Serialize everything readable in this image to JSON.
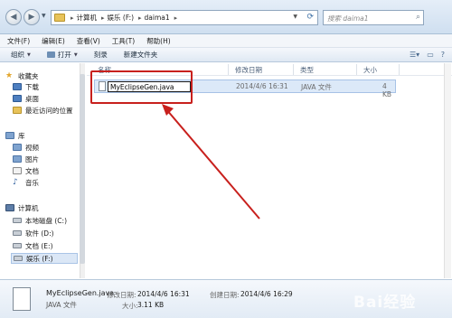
{
  "address": {
    "crumbs": [
      "计算机",
      "娱乐 (F:)",
      "daima1"
    ],
    "search_placeholder": "搜索 daima1"
  },
  "menu": [
    "文件(F)",
    "编辑(E)",
    "查看(V)",
    "工具(T)",
    "帮助(H)"
  ],
  "toolbar": {
    "organize": "组织",
    "open": "打开",
    "burn": "刻录",
    "new_folder": "新建文件夹"
  },
  "sidebar": {
    "favorites": "收藏夹",
    "downloads": "下载",
    "desktop": "桌面",
    "recent": "最近访问的位置",
    "libraries": "库",
    "videos": "视频",
    "pictures": "图片",
    "documents": "文档",
    "music": "音乐",
    "computer": "计算机",
    "local_disk": "本地磁盘 (C:)",
    "software": "软件 (D:)",
    "docs_drive": "文档 (E:)",
    "entertainment": "娱乐 (F:)"
  },
  "columns": {
    "name": "名称",
    "modified": "修改日期",
    "type": "类型",
    "size": "大小"
  },
  "file": {
    "name": "MyEclipseGen.java",
    "modified": "2014/4/6 16:31",
    "type": "JAVA 文件",
    "size": "4 KB"
  },
  "details": {
    "name": "MyEclipseGen.java",
    "type": "JAVA 文件",
    "modified_label": "修改日期:",
    "modified_value": "2014/4/6 16:31",
    "size_label": "大小:",
    "size_value": "3.11 KB",
    "created_label": "创建日期:",
    "created_value": "2014/4/6 16:29"
  },
  "watermark": "Bai经验",
  "colors": {
    "annotation_red": "#c8201d",
    "selection_blue": "#dce9f8",
    "chrome_blue": "#cfdff0"
  }
}
